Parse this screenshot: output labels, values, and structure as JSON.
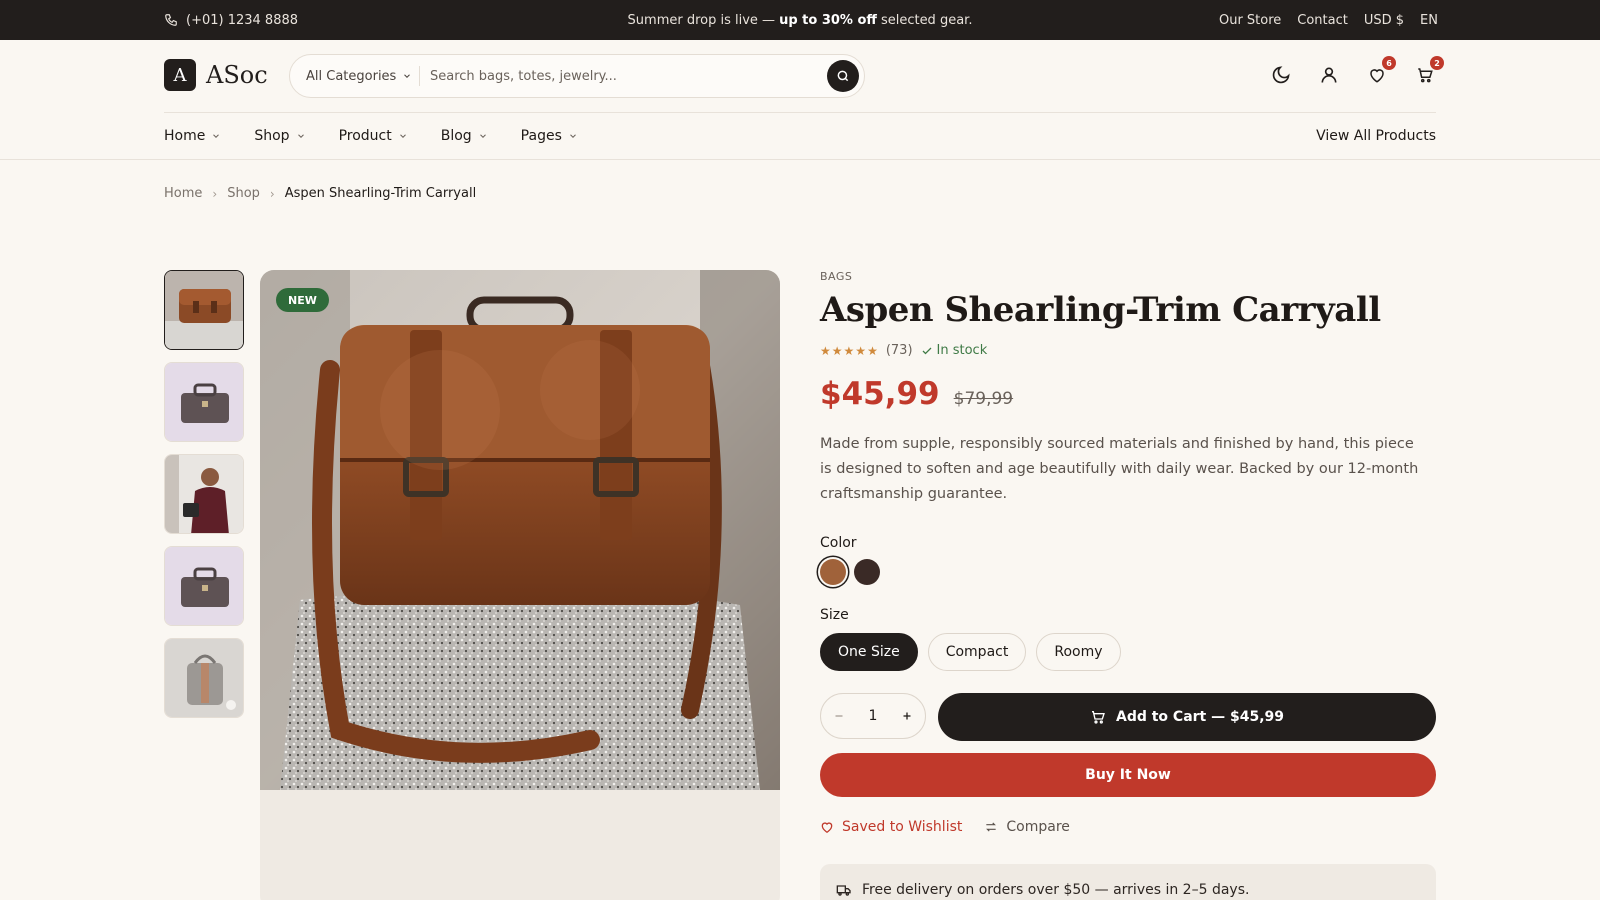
{
  "topbar": {
    "phone": "(+01) 1234 8888",
    "promo_pre": "Summer drop is live —",
    "promo_bold": "up to 30% off",
    "promo_post": "selected gear.",
    "links": [
      "Our Store",
      "Contact",
      "USD $",
      "EN"
    ]
  },
  "header": {
    "logo_mark": "A",
    "logo_text": "ASoc",
    "search": {
      "category": "All Categories",
      "placeholder": "Search bags, totes, jewelry..."
    },
    "wishlist_count": "6",
    "cart_count": "2",
    "icons": [
      "moon-icon",
      "user-icon",
      "heart-icon",
      "cart-icon"
    ]
  },
  "nav": {
    "items": [
      "Home",
      "Shop",
      "Product",
      "Blog",
      "Pages"
    ],
    "view_all": "View All Products"
  },
  "breadcrumb": [
    "Home",
    "Shop",
    "Aspen Shearling-Trim Carryall"
  ],
  "gallery": {
    "badge": "NEW",
    "thumbnails": [
      "brown-leather-bag",
      "grey-briefcase",
      "model-with-bag",
      "grey-briefcase",
      "grey-studded-bag"
    ],
    "selected_index": 0
  },
  "product": {
    "category": "BAGS",
    "title": "Aspen Shearling-Trim Carryall",
    "rating": 5,
    "review_count": "(73)",
    "stock": "In stock",
    "price": "$45,99",
    "old_price": "$79,99",
    "description": "Made from supple, responsibly sourced materials and finished by hand, this piece is designed to soften and age beautifully with daily wear. Backed by our 12-month craftsmanship guarantee.",
    "color_label": "Color",
    "colors": [
      "#a0623a",
      "#3a2a26"
    ],
    "selected_color": 0,
    "size_label": "Size",
    "sizes": [
      "One Size",
      "Compact",
      "Roomy"
    ],
    "selected_size": 0,
    "quantity": "1",
    "add_to_cart": "Add to Cart — $45,99",
    "buy_now": "Buy It Now",
    "wishlist": "Saved to Wishlist",
    "compare": "Compare",
    "delivery": "Free delivery on orders over $50 — arrives in 2–5 days."
  },
  "colors": {
    "accent": "#c0392b",
    "dark": "#221e1c",
    "success": "#2f6b3a",
    "background": "#faf7f2"
  }
}
